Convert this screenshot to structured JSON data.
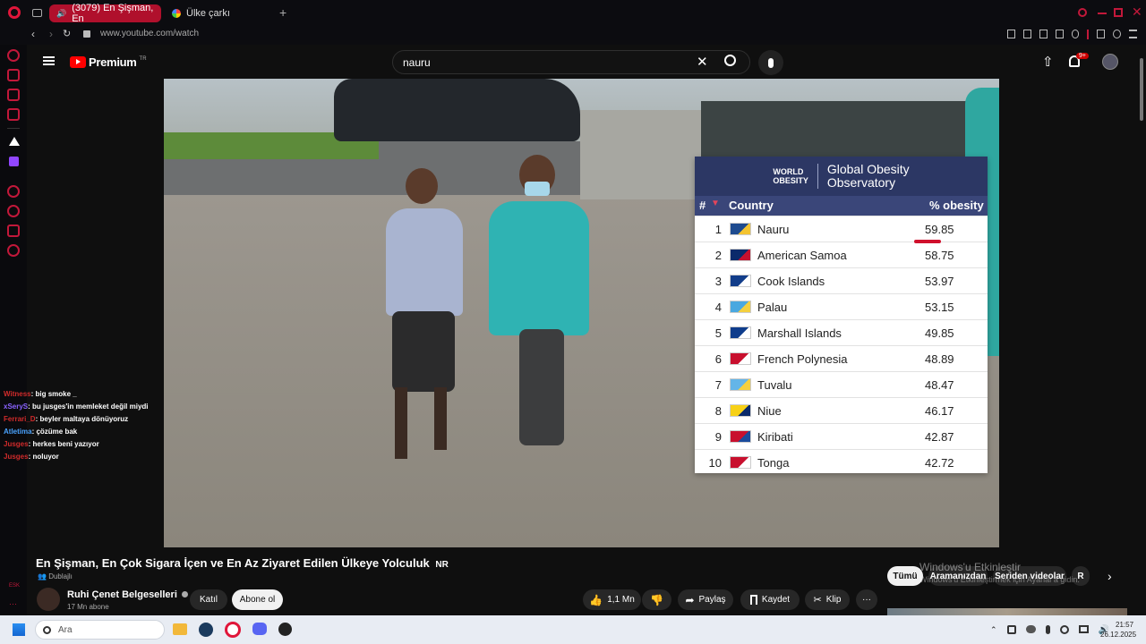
{
  "browser": {
    "tabs": [
      {
        "label": "(3079) En Şişman, En",
        "active": true
      },
      {
        "label": "Ülke çarkı",
        "active": false
      }
    ],
    "url": "www.youtube.com/watch"
  },
  "header": {
    "logo": "Premium",
    "region": "TR",
    "search_value": "nauru",
    "notif_badge": "9+"
  },
  "overlay": {
    "brand_top": "WORLD",
    "brand_bottom": "OBESITY",
    "title_line1": "Global Obesity",
    "title_line2": "Observatory",
    "columns": {
      "rank": "#",
      "country": "Country",
      "value": "% obesity"
    },
    "rows": [
      {
        "rank": "1",
        "country": "Nauru",
        "value": "59.85",
        "flag": [
          "#1e4b8f",
          "#f4c430"
        ]
      },
      {
        "rank": "2",
        "country": "American Samoa",
        "value": "58.75",
        "flag": [
          "#0a2a6b",
          "#c8102e"
        ]
      },
      {
        "rank": "3",
        "country": "Cook Islands",
        "value": "53.97",
        "flag": [
          "#123d8a",
          "#ffffff"
        ]
      },
      {
        "rank": "4",
        "country": "Palau",
        "value": "53.15",
        "flag": [
          "#4aa8e0",
          "#f4d03f"
        ]
      },
      {
        "rank": "5",
        "country": "Marshall Islands",
        "value": "49.85",
        "flag": [
          "#0f3d8c",
          "#ffffff"
        ]
      },
      {
        "rank": "6",
        "country": "French Polynesia",
        "value": "48.89",
        "flag": [
          "#c8102e",
          "#ffffff"
        ]
      },
      {
        "rank": "7",
        "country": "Tuvalu",
        "value": "48.47",
        "flag": [
          "#64b5e8",
          "#f4d03f"
        ]
      },
      {
        "rank": "8",
        "country": "Niue",
        "value": "46.17",
        "flag": [
          "#f7d117",
          "#0a2a6b"
        ]
      },
      {
        "rank": "9",
        "country": "Kiribati",
        "value": "42.87",
        "flag": [
          "#c8102e",
          "#1a4b9c"
        ]
      },
      {
        "rank": "10",
        "country": "Tonga",
        "value": "42.72",
        "flag": [
          "#c8102e",
          "#ffffff"
        ]
      }
    ]
  },
  "chat": [
    {
      "user": "Witness",
      "text": ": big smoke _",
      "color": "#d12b2b"
    },
    {
      "user": "xSeryS",
      "text": ": bu jusges'in memleket değil miydi",
      "color": "#8a63ff"
    },
    {
      "user": "Ferrari_D",
      "text": ": beyler maltaya dönüyoruz",
      "color": "#d12b2b"
    },
    {
      "user": "Atletima",
      "text": ": çözüme bak",
      "color": "#4aa3ff"
    },
    {
      "user": "Jusges",
      "text": ": herkes beni yazıyor",
      "color": "#d12b2b"
    },
    {
      "user": "Jusges",
      "text": ": noluyor",
      "color": "#d12b2b"
    }
  ],
  "video_info": {
    "title": "En Şişman, En Çok Sigara İçen ve En Az Ziyaret Edilen Ülkeye Yolculuk",
    "rating": "NR",
    "dub": "Dublajlı",
    "channel": "Ruhi Çenet Belgeselleri",
    "subs": "17 Mn abone",
    "join": "Katıl",
    "subscribe": "Abone ol",
    "likes": "1,1 Mn",
    "share": "Paylaş",
    "save": "Kaydet",
    "clip": "Klip",
    "chips": [
      "Tümü",
      "Aramanızdan",
      "Seriden videolar",
      "R"
    ],
    "watermark1": "Windows'u Etkinleştir",
    "watermark2": "Windows'u Etkinleştirmek için Ayarlar'a gidin."
  },
  "sidebar_bottom": "ESK",
  "taskbar": {
    "search_placeholder": "Ara",
    "time": "21:57",
    "date": "26.12.2025"
  }
}
